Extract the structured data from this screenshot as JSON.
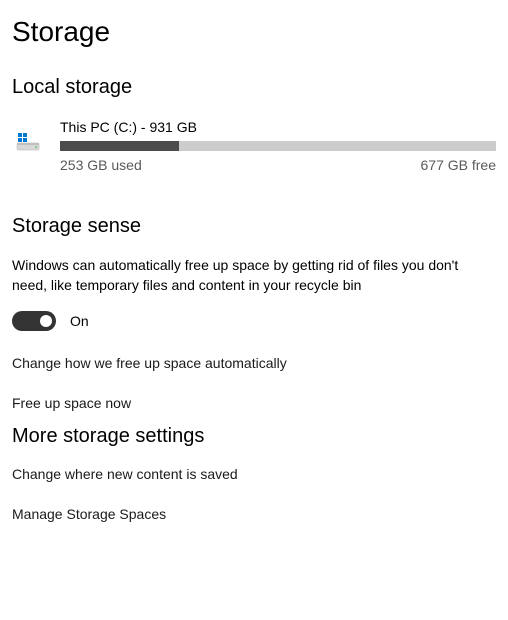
{
  "page": {
    "title": "Storage"
  },
  "local_storage": {
    "heading": "Local storage",
    "drive": {
      "name": "This PC (C:) - 931 GB",
      "used_label": "253 GB used",
      "free_label": "677 GB free",
      "total_gb": 931,
      "used_gb": 253,
      "free_gb": 677,
      "fill_percent": 27.2
    }
  },
  "storage_sense": {
    "heading": "Storage sense",
    "description": "Windows can automatically free up space by getting rid of files you don't need, like temporary files and content in your recycle bin",
    "toggle": {
      "state": "On",
      "enabled": true
    },
    "links": {
      "change_auto": "Change how we free up space automatically",
      "free_now": "Free up space now"
    }
  },
  "more_settings": {
    "heading": "More storage settings",
    "links": {
      "change_save": "Change where new content is saved",
      "manage_spaces": "Manage Storage Spaces"
    }
  }
}
